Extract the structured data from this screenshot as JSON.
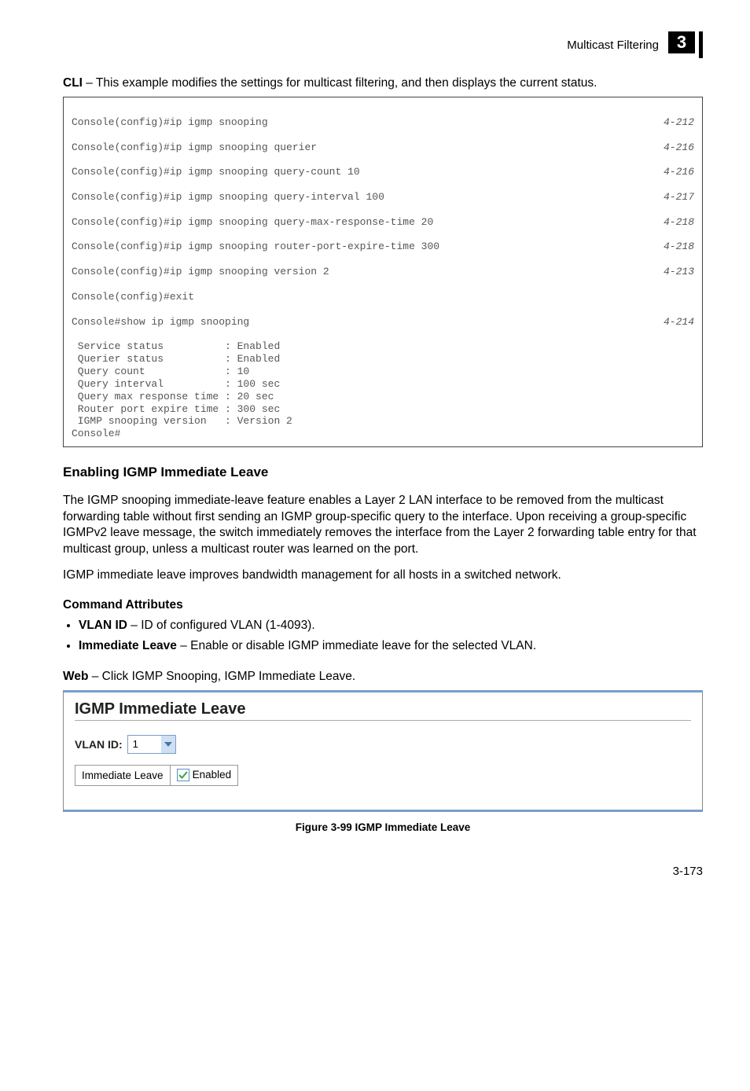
{
  "header": {
    "title": "Multicast Filtering",
    "page_icon_number": "3"
  },
  "intro": {
    "prefix": "CLI",
    "text": " – This example modifies the settings for multicast filtering, and then displays the current status."
  },
  "code": {
    "cmd_lines": [
      {
        "cmd": "Console(config)#ip igmp snooping",
        "ref": "4-212"
      },
      {
        "cmd": "Console(config)#ip igmp snooping querier",
        "ref": "4-216"
      },
      {
        "cmd": "Console(config)#ip igmp snooping query-count 10",
        "ref": "4-216"
      },
      {
        "cmd": "Console(config)#ip igmp snooping query-interval 100",
        "ref": "4-217"
      },
      {
        "cmd": "Console(config)#ip igmp snooping query-max-response-time 20",
        "ref": "4-218"
      },
      {
        "cmd": "Console(config)#ip igmp snooping router-port-expire-time 300",
        "ref": "4-218"
      },
      {
        "cmd": "Console(config)#ip igmp snooping version 2",
        "ref": "4-213"
      },
      {
        "cmd": "Console(config)#exit",
        "ref": ""
      },
      {
        "cmd": "Console#show ip igmp snooping",
        "ref": "4-214"
      }
    ],
    "output_lines": [
      " Service status          : Enabled",
      " Querier status          : Enabled",
      " Query count             : 10",
      " Query interval          : 100 sec",
      " Query max response time : 20 sec",
      " Router port expire time : 300 sec",
      " IGMP snooping version   : Version 2",
      "Console#"
    ]
  },
  "section": {
    "title": "Enabling IGMP Immediate Leave",
    "body1": "The IGMP snooping immediate-leave feature enables a Layer 2 LAN interface to be removed from the multicast forwarding table without first sending an IGMP group-specific query to the interface. Upon receiving a group-specific IGMPv2 leave message, the switch immediately removes the interface from the Layer 2 forwarding table entry for that multicast group, unless a multicast router was learned on the port.",
    "body2": "IGMP immediate leave improves bandwidth management for all hosts in a switched network.",
    "attr_heading": "Command Attributes",
    "attrs": [
      {
        "name": "VLAN ID",
        "desc": " – ID of configured VLAN (1-4093)."
      },
      {
        "name": "Immediate Leave",
        "desc": " – Enable or disable IGMP immediate leave for the selected VLAN."
      }
    ],
    "web_prefix": "Web",
    "web_text": " – Click IGMP Snooping, IGMP Immediate Leave."
  },
  "screenshot": {
    "title": "IGMP Immediate Leave",
    "vlan_label": "VLAN ID:",
    "vlan_value": "1",
    "row_label": "Immediate Leave",
    "checkbox_label": "Enabled",
    "checkbox_checked": true
  },
  "figure_caption": "Figure 3-99  IGMP Immediate Leave",
  "footer_page": "3-173"
}
